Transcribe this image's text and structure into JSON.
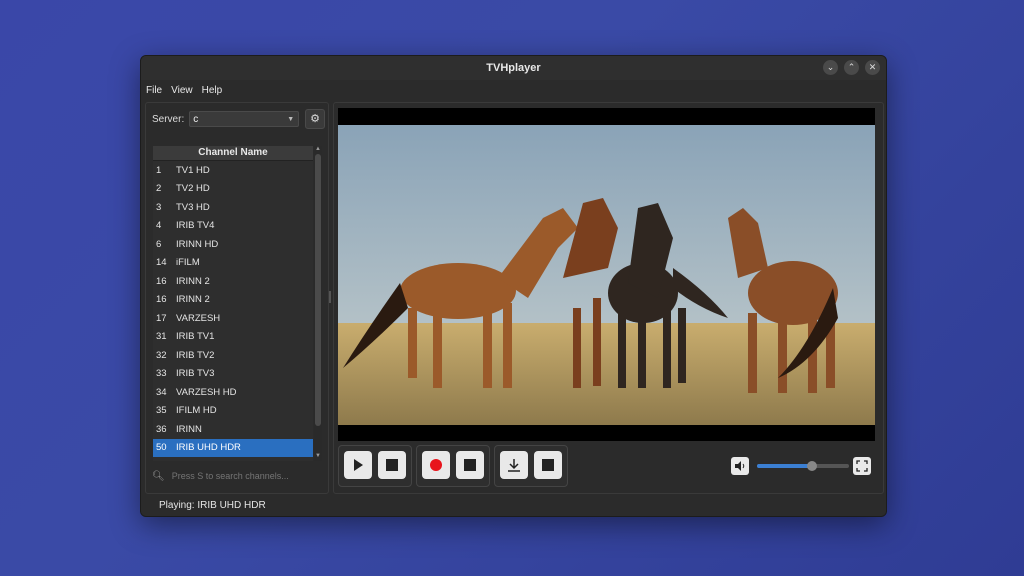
{
  "window": {
    "title": "TVHplayer"
  },
  "menu": [
    "File",
    "View",
    "Help"
  ],
  "server": {
    "label": "Server:",
    "value": "c"
  },
  "channel_list": {
    "header": "Channel Name",
    "rows": [
      {
        "num": "1",
        "name": "TV1 HD"
      },
      {
        "num": "2",
        "name": "TV2 HD"
      },
      {
        "num": "3",
        "name": "TV3 HD"
      },
      {
        "num": "4",
        "name": "IRIB TV4"
      },
      {
        "num": "6",
        "name": "IRINN HD"
      },
      {
        "num": "14",
        "name": "iFILM"
      },
      {
        "num": "16",
        "name": "IRINN 2"
      },
      {
        "num": "16",
        "name": "IRINN 2"
      },
      {
        "num": "17",
        "name": "VARZESH"
      },
      {
        "num": "31",
        "name": "IRIB TV1"
      },
      {
        "num": "32",
        "name": "IRIB TV2"
      },
      {
        "num": "33",
        "name": "IRIB TV3"
      },
      {
        "num": "34",
        "name": "VARZESH HD"
      },
      {
        "num": "35",
        "name": "IFILM HD"
      },
      {
        "num": "36",
        "name": "IRINN"
      },
      {
        "num": "50",
        "name": "IRIB UHD HDR"
      }
    ],
    "selected_index": 15
  },
  "search": {
    "placeholder": "Press S to search channels..."
  },
  "volume": {
    "level": 0.6
  },
  "colors": {
    "selection": "#2a6fc0",
    "record": "#e8141c",
    "accent": "#3b7fd3"
  },
  "status": {
    "text": "Playing: IRIB UHD HDR"
  }
}
